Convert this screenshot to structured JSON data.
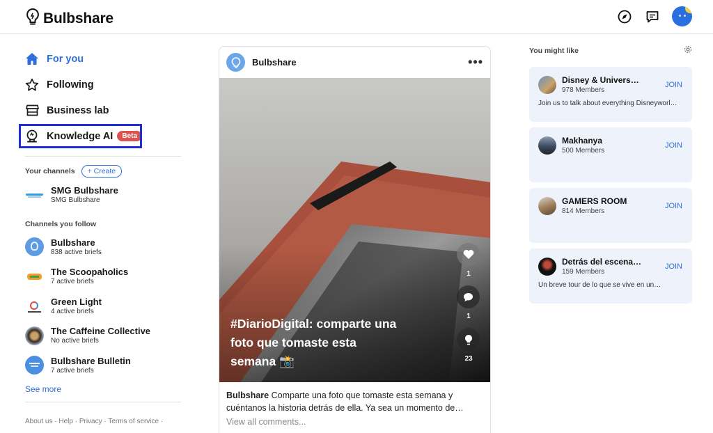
{
  "header": {
    "app_name": "Bulbshare"
  },
  "nav": {
    "items": [
      {
        "label": "For you"
      },
      {
        "label": "Following"
      },
      {
        "label": "Business lab"
      },
      {
        "label": "Knowledge AI",
        "badge": "Beta"
      }
    ]
  },
  "your_channels": {
    "label": "Your channels",
    "create_label": "+ Create",
    "items": [
      {
        "name": "SMG Bulbshare",
        "sub": "SMG Bulbshare"
      }
    ]
  },
  "channels_follow": {
    "label": "Channels you follow",
    "items": [
      {
        "name": "Bulbshare",
        "sub": "838 active briefs"
      },
      {
        "name": "The Scoopaholics",
        "sub": "7 active briefs"
      },
      {
        "name": "Green Light",
        "sub": "4 active briefs"
      },
      {
        "name": "The Caffeine Collective",
        "sub": "No active briefs"
      },
      {
        "name": "Bulbshare Bulletin",
        "sub": "7 active briefs"
      }
    ],
    "see_more": "See more"
  },
  "footer": {
    "links": "About us · Help · Privacy · Terms of service ·"
  },
  "post": {
    "author": "Bulbshare",
    "more": "•••",
    "overlay_text": "#DiarioDigital: comparte una foto que tomaste esta semana 📸",
    "likes": "1",
    "comments": "1",
    "ideas": "23",
    "caption_author": "Bulbshare",
    "caption_text": "Comparte una foto que tomaste esta semana y cuéntanos la historia detrás de ella. Ya sea un momento de…",
    "view_comments": "View all comments..."
  },
  "suggestions": {
    "title": "You might like",
    "join_label": "JOIN",
    "cards": [
      {
        "name": "Disney & Universa…",
        "members": "978 Members",
        "desc": "Join us to talk about everything Disneyworl…"
      },
      {
        "name": "Makhanya",
        "members": "500 Members",
        "desc": ""
      },
      {
        "name": "GAMERS ROOM",
        "members": "814 Members",
        "desc": ""
      },
      {
        "name": "Detrás del escena…",
        "members": "159 Members",
        "desc": "Un breve tour de lo que se vive en un…"
      }
    ]
  },
  "colors": {
    "accent": "#2f6fd9",
    "highlight_box": "#1e2fd6",
    "beta_badge": "#d9534f",
    "card_bg": "#eef3fb"
  },
  "icons": {
    "logo": "lightbulb-icon",
    "explore": "compass-icon",
    "messages": "chat-icon",
    "nav": [
      "home-icon",
      "star-icon",
      "store-icon",
      "brain-bulb-icon"
    ],
    "settings": "gear-icon",
    "post_actions": [
      "heart-icon",
      "comment-icon",
      "bulb-icon"
    ]
  }
}
